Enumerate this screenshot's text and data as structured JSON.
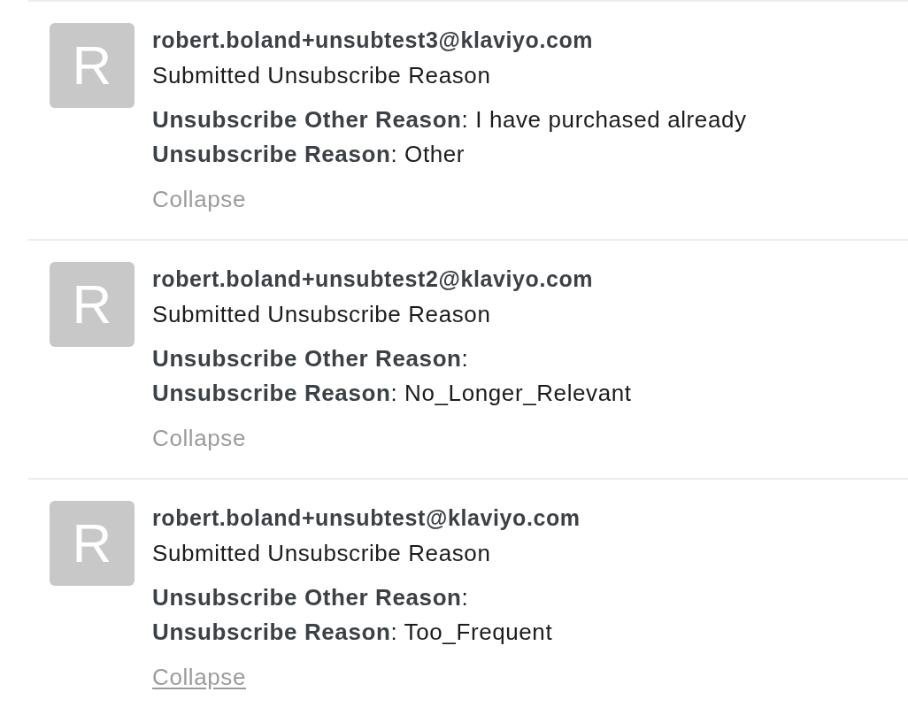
{
  "events": [
    {
      "avatar_initial": "R",
      "email": "robert.boland+unsubtest3@klaviyo.com",
      "action": "Submitted Unsubscribe Reason",
      "properties": [
        "**Unsubscribe Other Reason**: I have purchased already",
        "**Unsubscribe Reason**: Other"
      ],
      "collapse": {
        "label": "Collapse",
        "hovered": false
      }
    },
    {
      "avatar_initial": "R",
      "email": "robert.boland+unsubtest2@klaviyo.com",
      "action": "Submitted Unsubscribe Reason",
      "properties": [
        "**Unsubscribe Other Reason**:",
        "**Unsubscribe Reason**: No_Longer_Relevant"
      ],
      "collapse": {
        "label": "Collapse",
        "hovered": false
      }
    },
    {
      "avatar_initial": "R",
      "email": "robert.boland+unsubtest@klaviyo.com",
      "action": "Submitted Unsubscribe Reason",
      "properties": [
        "**Unsubscribe Other Reason**:",
        "**Unsubscribe Reason**: Too_Frequent"
      ],
      "collapse": {
        "label": "Collapse",
        "hovered": true
      }
    }
  ]
}
